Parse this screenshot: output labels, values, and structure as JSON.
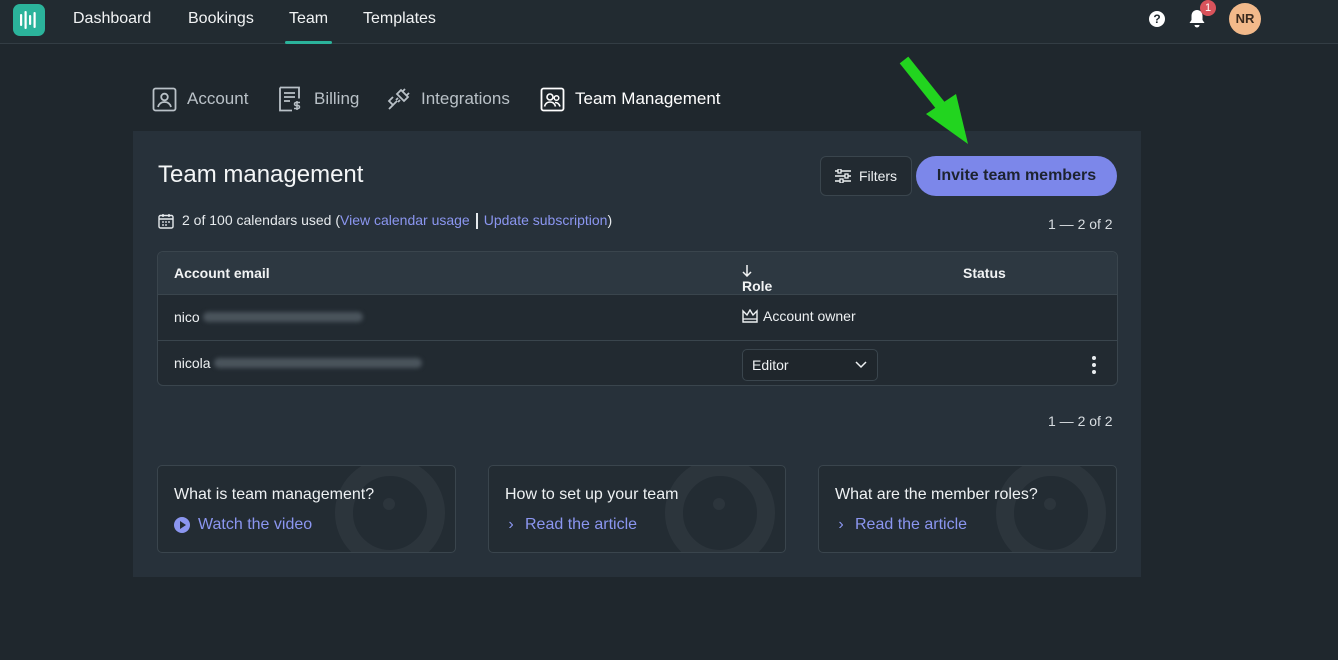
{
  "nav": {
    "items": [
      {
        "label": "Dashboard"
      },
      {
        "label": "Bookings"
      },
      {
        "label": "Team"
      },
      {
        "label": "Templates"
      }
    ],
    "active_index": 2,
    "notifications_count": "1",
    "avatar_initials": "NR",
    "help_glyph": "?"
  },
  "subtabs": [
    {
      "label": "Account",
      "icon": "account-icon"
    },
    {
      "label": "Billing",
      "icon": "billing-icon"
    },
    {
      "label": "Integrations",
      "icon": "plug-icon"
    },
    {
      "label": "Team Management",
      "icon": "team-icon"
    }
  ],
  "panel": {
    "title": "Team management",
    "filters_label": "Filters",
    "invite_label": "Invite team members",
    "usage": {
      "text": "2 of 100 calendars used (",
      "link1": "View calendar usage",
      "link2": "Update subscription",
      "close": ")"
    },
    "pager_top": "1 — 2 of 2",
    "pager_bottom": "1 — 2 of 2"
  },
  "table": {
    "headers": {
      "email": "Account email",
      "role": "Role",
      "status": "Status"
    },
    "rows": [
      {
        "email_prefix": "nico",
        "role": "Account owner",
        "role_type": "static"
      },
      {
        "email_prefix": "nicola",
        "role": "Editor",
        "role_type": "select"
      }
    ]
  },
  "help_cards": [
    {
      "title": "What is team management?",
      "cta": "Watch the video",
      "cta_icon": "play-icon"
    },
    {
      "title": "How to set up your team",
      "cta": "Read the article",
      "cta_icon": "chevron-right-icon"
    },
    {
      "title": "What are the member roles?",
      "cta": "Read the article",
      "cta_icon": "chevron-right-icon"
    }
  ],
  "colors": {
    "accent": "#2bb39b",
    "primary_button": "#7c87ea",
    "link": "#8b96f0",
    "annotation_arrow": "#22d41f"
  }
}
